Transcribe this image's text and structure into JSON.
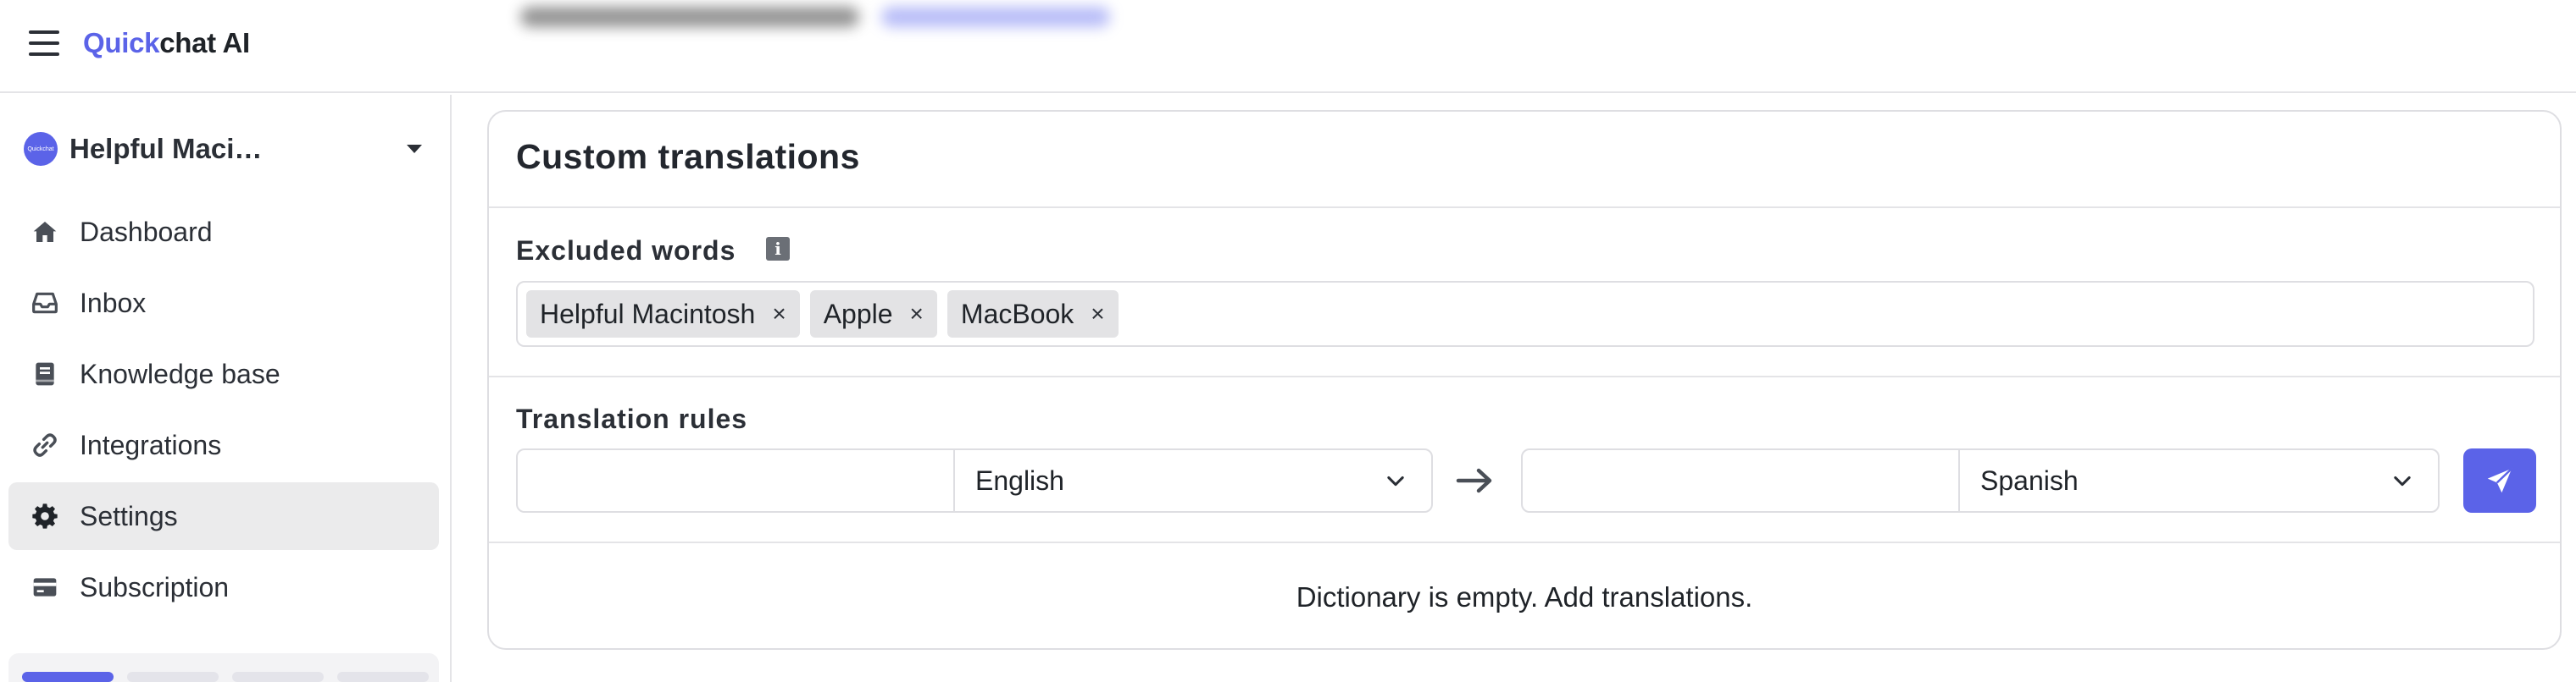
{
  "app": {
    "brand_accent": "Quick",
    "brand_rest": "chat AI",
    "accent_color": "#5b63e8"
  },
  "sidebar": {
    "bot": {
      "avatar_text": "Quickchat",
      "name": "Helpful Maci…"
    },
    "items": [
      {
        "label": "Dashboard",
        "icon": "home-icon",
        "active": false
      },
      {
        "label": "Inbox",
        "icon": "inbox-icon",
        "active": false
      },
      {
        "label": "Knowledge base",
        "icon": "book-icon",
        "active": false
      },
      {
        "label": "Integrations",
        "icon": "link-icon",
        "active": false
      },
      {
        "label": "Settings",
        "icon": "gear-icon",
        "active": true
      },
      {
        "label": "Subscription",
        "icon": "credit-card-icon",
        "active": false
      }
    ]
  },
  "main": {
    "title": "Custom translations",
    "excluded": {
      "label": "Excluded words",
      "info_icon": "i",
      "tags": [
        "Helpful Macintosh",
        "Apple",
        "MacBook"
      ],
      "remove_glyph": "×"
    },
    "rules": {
      "label": "Translation rules",
      "source_value": "",
      "source_language": "English",
      "target_value": "",
      "target_language": "Spanish"
    },
    "empty_message": "Dictionary is empty. Add translations."
  }
}
